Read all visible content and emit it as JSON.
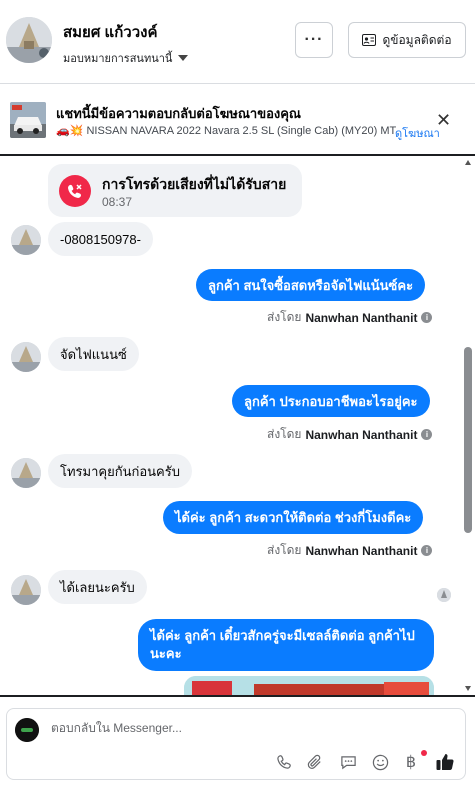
{
  "header": {
    "name": "สมยศ แก้ววงค์",
    "assign_label": "มอบหมายการสนทนานี้",
    "more_label": "···",
    "contact_label": "ดูข้อมูลติดต่อ"
  },
  "ad_banner": {
    "title": "แชทนี้มีข้อความตอบกลับต่อโฆษณาของคุณ",
    "line": "🚗💥 NISSAN NAVARA 2022 Navara 2.5 SL (Single Cab) (MY20) MT *...",
    "link": "ดูโฆษณา",
    "close_label": "✕"
  },
  "messages": {
    "missed_call_title": "การโทรด้วยเสียงที่ไม่ได้รับสาย",
    "missed_call_time": "08:37",
    "m1": "-0808150978-",
    "m2": "ลูกค้า สนใจซื้อสดหรือจัดไฟแน้นซ์คะ",
    "m3": "จัดไฟแนนซ์",
    "m4": "ลูกค้า ประกอบอาชีพอะไรอยู่คะ",
    "m5": "โทรมาคุยกันก่อนครับ",
    "m6": "ได้ค่ะ  ลูกค้า สะดวกให้ติดต่อ ช่วงกี่โมงดีคะ",
    "m7": "ได้เลยนะครับ",
    "m8": "ได้ค่ะ  ลูกค้า เดี๋ยวสักครู่จะมีเซลล์ติดต่อ ลูกค้าไปนะคะ",
    "sent_by_prefix": "ส่งโดย",
    "sent_by_name": "Nanwhan Nanthanit",
    "info_icon": "i"
  },
  "composer": {
    "placeholder": "ตอบกลับใน Messenger..."
  },
  "colors": {
    "accent": "#0a7cff",
    "incoming_bubble": "#f0f2f5",
    "missed_call": "#f02849",
    "link": "#1877f2"
  },
  "icons": [
    "phone-icon",
    "paperclip-icon",
    "saved-reply-icon",
    "emoji-icon",
    "baht-icon",
    "thumbs-up-icon",
    "close-icon",
    "contact-card-icon"
  ]
}
